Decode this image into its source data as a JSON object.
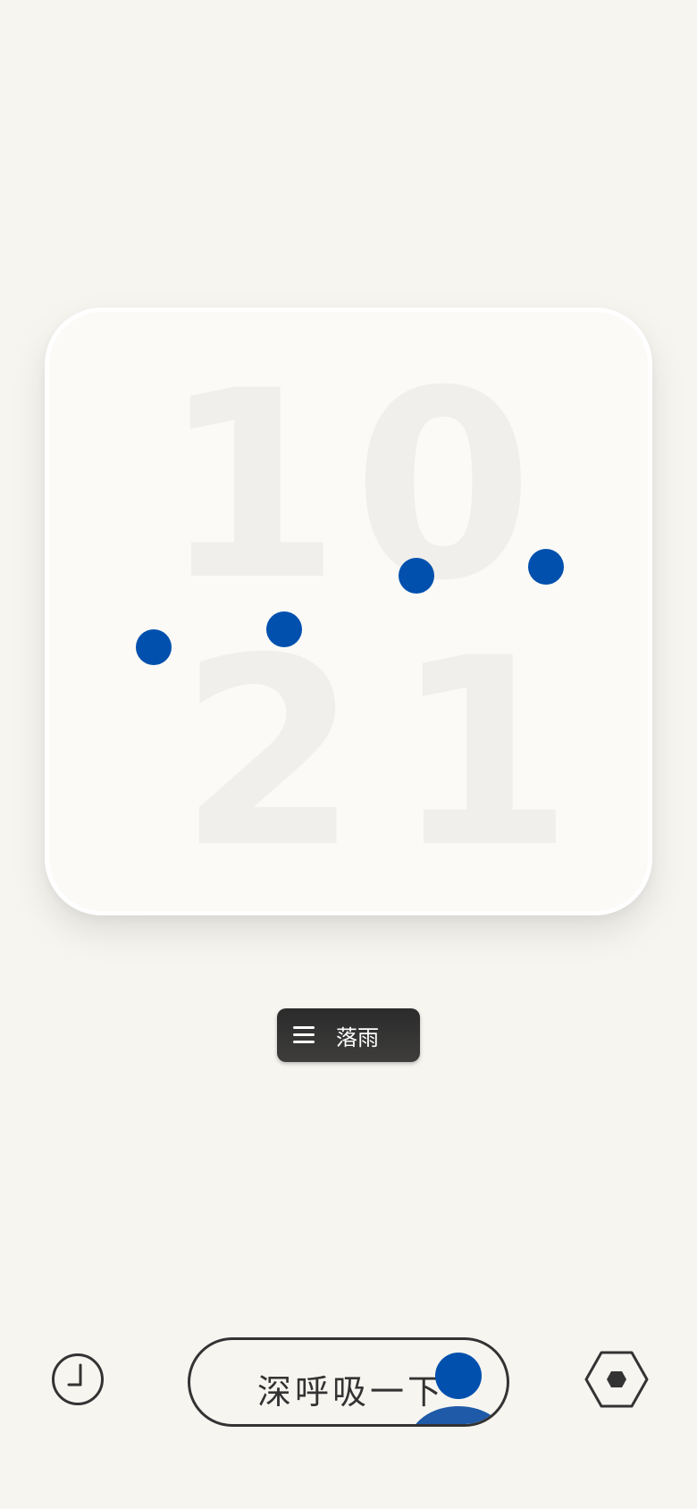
{
  "clock": {
    "hour_tens": "1",
    "hour_ones": "0",
    "minute_tens": "2",
    "minute_ones": "1"
  },
  "mode_button": {
    "icon": "menu-icon",
    "label": "落雨"
  },
  "bottom_bar": {
    "left_icon": "clock-icon",
    "breath_label": "深呼吸一下",
    "right_icon": "hexagon-settings-icon"
  },
  "colors": {
    "background": "#f7f5f0",
    "accent": "#0150ae",
    "dark": "#333333"
  }
}
